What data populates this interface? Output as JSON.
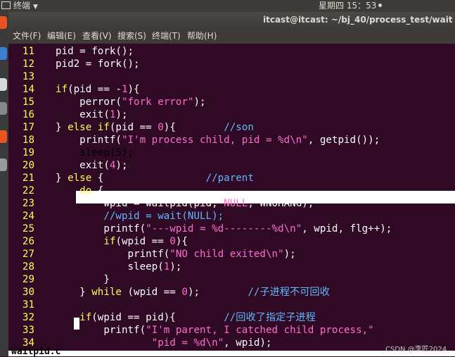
{
  "topbar": {
    "app_label": "终端",
    "clock": "星期四 15：53"
  },
  "window": {
    "title": "itcast@itcast: ~/bj_40/process_test/wait"
  },
  "menu": [
    "文件(F)",
    "编辑(E)",
    "查看(V)",
    "搜索(S)",
    "终端(T)",
    "帮助(H)"
  ],
  "code_lines": [
    {
      "n": "11",
      "parts": [
        {
          "t": "pid = fork();",
          "c": ""
        }
      ]
    },
    {
      "n": "12",
      "parts": [
        {
          "t": "pid2 = fork();",
          "c": ""
        }
      ]
    },
    {
      "n": "13",
      "parts": []
    },
    {
      "n": "14",
      "parts": [
        {
          "t": "if",
          "c": "kw"
        },
        {
          "t": "(pid == -",
          "c": ""
        },
        {
          "t": "1",
          "c": "const"
        },
        {
          "t": "){",
          "c": ""
        }
      ]
    },
    {
      "n": "15",
      "parts": [
        {
          "t": "    perror(",
          "c": ""
        },
        {
          "t": "\"fork error\"",
          "c": "str"
        },
        {
          "t": ");",
          "c": ""
        }
      ]
    },
    {
      "n": "16",
      "parts": [
        {
          "t": "    exit(",
          "c": ""
        },
        {
          "t": "1",
          "c": "const"
        },
        {
          "t": ");",
          "c": ""
        }
      ]
    },
    {
      "n": "17",
      "parts": [
        {
          "t": "} ",
          "c": ""
        },
        {
          "t": "else if",
          "c": "kw"
        },
        {
          "t": "(pid == ",
          "c": ""
        },
        {
          "t": "0",
          "c": "const"
        },
        {
          "t": "){        ",
          "c": ""
        },
        {
          "t": "//son",
          "c": "com"
        }
      ]
    },
    {
      "n": "18",
      "parts": [
        {
          "t": "    printf(",
          "c": ""
        },
        {
          "t": "\"I'm process child, pid = %d\\n\"",
          "c": "str"
        },
        {
          "t": ", getpid());",
          "c": ""
        }
      ]
    },
    {
      "n": "19",
      "parts": [
        {
          "t": "    sleep(5);",
          "c": ""
        }
      ],
      "highlight": true
    },
    {
      "n": "20",
      "parts": [
        {
          "t": "    exit(",
          "c": ""
        },
        {
          "t": "4",
          "c": "const"
        },
        {
          "t": ");",
          "c": ""
        }
      ]
    },
    {
      "n": "21",
      "parts": [
        {
          "t": "} ",
          "c": ""
        },
        {
          "t": "else",
          "c": "kw"
        },
        {
          "t": " {                 ",
          "c": ""
        },
        {
          "t": "//parent",
          "c": "com"
        }
      ]
    },
    {
      "n": "22",
      "parts": [
        {
          "t": "    ",
          "c": ""
        },
        {
          "t": "do",
          "c": "kw"
        },
        {
          "t": " {",
          "c": ""
        }
      ]
    },
    {
      "n": "23",
      "parts": [
        {
          "t": "        wpid = waitpid(pid, ",
          "c": ""
        },
        {
          "t": "NULL",
          "c": "const"
        },
        {
          "t": ", WNOHANG);",
          "c": ""
        }
      ]
    },
    {
      "n": "24",
      "parts": [
        {
          "t": "        ",
          "c": ""
        },
        {
          "t": "//wpid = wait(NULL);",
          "c": "com"
        }
      ]
    },
    {
      "n": "25",
      "parts": [
        {
          "t": "        printf(",
          "c": ""
        },
        {
          "t": "\"---wpid = %d--------%d\\n\"",
          "c": "str"
        },
        {
          "t": ", wpid, flg++);",
          "c": ""
        }
      ]
    },
    {
      "n": "26",
      "parts": [
        {
          "t": "        ",
          "c": ""
        },
        {
          "t": "if",
          "c": "kw"
        },
        {
          "t": "(wpid == ",
          "c": ""
        },
        {
          "t": "0",
          "c": "const"
        },
        {
          "t": "){",
          "c": ""
        }
      ]
    },
    {
      "n": "27",
      "parts": [
        {
          "t": "            printf(",
          "c": ""
        },
        {
          "t": "\"NO child exited\\n\"",
          "c": "str"
        },
        {
          "t": ");",
          "c": ""
        }
      ]
    },
    {
      "n": "28",
      "parts": [
        {
          "t": "            sleep(",
          "c": ""
        },
        {
          "t": "1",
          "c": "const"
        },
        {
          "t": ");",
          "c": ""
        }
      ]
    },
    {
      "n": "29",
      "parts": [
        {
          "t": "        }",
          "c": ""
        }
      ]
    },
    {
      "n": "30",
      "parts": [
        {
          "t": "    } ",
          "c": ""
        },
        {
          "t": "while",
          "c": "kw"
        },
        {
          "t": " (wpid == ",
          "c": ""
        },
        {
          "t": "0",
          "c": "const"
        },
        {
          "t": ");        ",
          "c": ""
        },
        {
          "t": "//子进程不可回收",
          "c": "com"
        }
      ]
    },
    {
      "n": "31",
      "parts": []
    },
    {
      "n": "32",
      "parts": [
        {
          "t": "    ",
          "c": ""
        },
        {
          "t": "if",
          "c": "kw"
        },
        {
          "t": "(wpid == pid){        ",
          "c": ""
        },
        {
          "t": "//回收了指定子进程",
          "c": "com"
        }
      ]
    },
    {
      "n": "33",
      "parts": [
        {
          "t": "        printf(",
          "c": ""
        },
        {
          "t": "\"I'm parent, I catched child process,\"",
          "c": "str"
        }
      ]
    },
    {
      "n": "34",
      "parts": [
        {
          "t": "                ",
          "c": ""
        },
        {
          "t": "\"pid = %d\\n\"",
          "c": "str"
        },
        {
          "t": ", wpid);",
          "c": ""
        }
      ]
    }
  ],
  "status_filename": "waitpid.c",
  "watermark": "CSDN @李匠2024",
  "colors": {
    "terminal_bg": "#300a24",
    "line_number": "#ffff54",
    "keyword": "#ffff54",
    "string": "#ff6bd0",
    "comment": "#5fb8ff"
  }
}
